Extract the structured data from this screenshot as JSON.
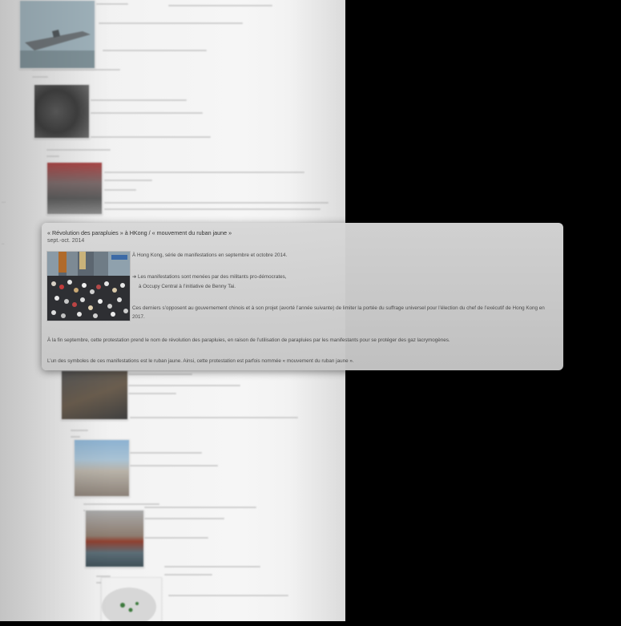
{
  "popup": {
    "title": "« Révolution des parapluies » à HKong / « mouvement du ruban jaune »",
    "date": "sept.-oct. 2014",
    "paragraph_1": "À Hong Kong, série de manifestations en septembre et octobre 2014.",
    "bullet_marker": "➔",
    "bullet_line_1": "Les manifestations sont menées par des militants pro-démocrates,",
    "bullet_line_2": "à Occupy Central à l’initiative de Benny Tai.",
    "paragraph_3": "Ces derniers s’opposent au gouvernement chinois et à son projet (avorté l’année suivante) de limiter la portée du suffrage universel pour l’élection du chef de l’exécutif de Hong Kong en 2017.",
    "paragraph_4": "À la fin septembre, cette protestation prend le nom de révolution des parapluies, en raison de l’utilisation de parapluies par les manifestants pour se protéger des gaz lacrymogènes.",
    "paragraph_5": "L’un des symboles de ces manifestations est le ruban jaune. Ainsi, cette protestation est parfois nommée « mouvement du ruban jaune »."
  },
  "colors": {
    "background": "#000000",
    "card": "#d0d0d0",
    "page": "#f2f2f2"
  },
  "icons": {
    "bullet": "arrow-right-icon"
  }
}
